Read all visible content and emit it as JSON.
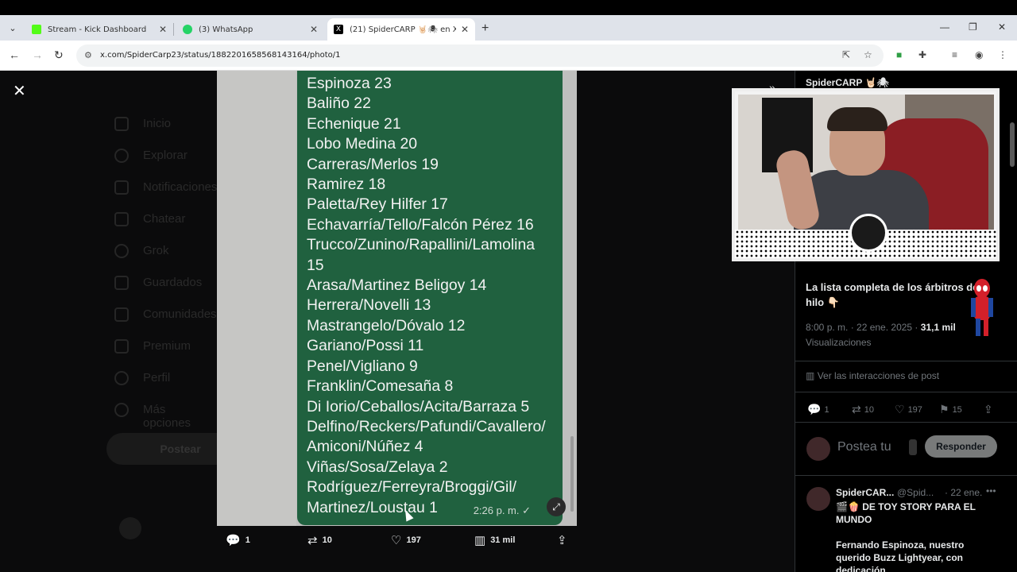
{
  "browser": {
    "tabs": [
      {
        "label": "Stream - Kick Dashboard",
        "icon": "kick-icon",
        "color": "#53fc18"
      },
      {
        "label": "(3) WhatsApp",
        "icon": "whatsapp-icon",
        "color": "#25d366"
      },
      {
        "label": "(21) SpiderCARP 🤘🏻🕷 en X: \"L",
        "icon": "x-icon",
        "color": "#000000"
      }
    ],
    "url": "x.com/SpiderCarp23/status/1882201658568143164/photo/1"
  },
  "background_nav": {
    "items": [
      "Inicio",
      "Explorar",
      "Notificaciones",
      "Chatear",
      "Grok",
      "Guardados",
      "Comunidades",
      "Premium",
      "Perfil",
      "Más opciones"
    ],
    "post_button": "Postear"
  },
  "photo": {
    "lines": [
      "Espinoza 23",
      "Baliño 22",
      "Echenique 21",
      "Lobo Medina 20",
      "Carreras/Merlos 19",
      "Ramirez 18",
      "Paletta/Rey Hilfer 17",
      "Echavarría/Tello/Falcón Pérez 16",
      "Trucco/Zunino/Rapallini/Lamolina",
      "15",
      "Arasa/Martinez Beligoy 14",
      "Herrera/Novelli 13",
      "Mastrangelo/Dóvalo 12",
      "Gariano/Possi 11",
      "Penel/Vigliano 9",
      "Franklin/Comesaña 8",
      "Di Iorio/Ceballos/Acita/Barraza 5",
      "Delfino/Reckers/Pafundi/Cavallero/",
      "Amiconi/Núñez 4",
      "Viñas/Sosa/Zelaya 2",
      "Rodríguez/Ferreyra/Broggi/Gil/",
      "Martinez/Loustau 1"
    ],
    "timestamp": "2:26 p. m. ✓"
  },
  "actions": {
    "replies": "1",
    "reposts": "10",
    "likes": "197",
    "views": "31 mil"
  },
  "panel": {
    "author": "SpiderCARP 🤘🏻🕷",
    "post_text": "La lista completa de los árbitros del hilo 👇🏻",
    "time": "8:00 p. m. · 22 ene. 2025 · ",
    "views_count": "31,1 mil",
    "views_label": "Visualizaciones",
    "interactions": "Ver las interacciones de post",
    "replies": "1",
    "reposts": "10",
    "likes": "197",
    "bookmarks": "15",
    "reply_placeholder": "Postea tu",
    "reply_button": "Responder",
    "reply2": {
      "name": "SpiderCAR...",
      "handle": "@Spid...",
      "date": "· 22 ene.",
      "text1": "🎬🍿 DE TOY STORY PARA EL MUNDO",
      "text2": "Fernando Espinoza, nuestro querido Buzz Lightyear, con dedicación"
    }
  }
}
